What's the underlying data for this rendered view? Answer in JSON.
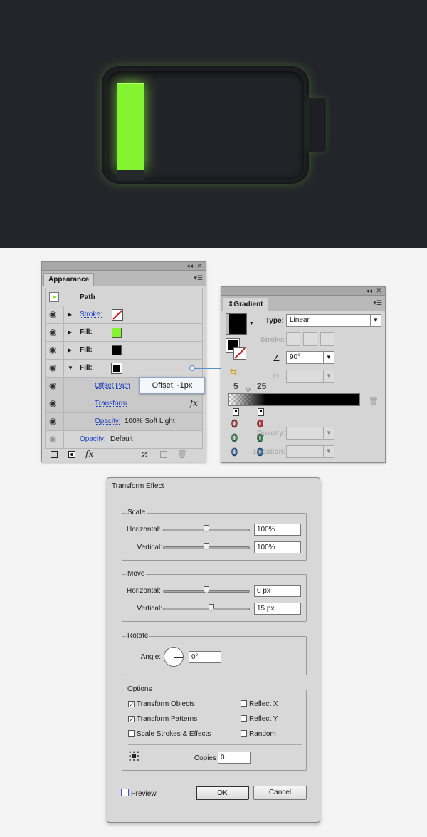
{
  "appearance": {
    "tab_title": "Appearance",
    "header_label": "Path",
    "rows": [
      {
        "label": "Stroke:",
        "is_link": true,
        "expanded": false
      },
      {
        "label": "Fill:",
        "is_link": false,
        "expanded": false,
        "swatch_color": "#85f430"
      },
      {
        "label": "Fill:",
        "is_link": false,
        "expanded": false,
        "swatch_color": "#000000"
      },
      {
        "label": "Fill:",
        "is_link": false,
        "expanded": true,
        "swatch_color": "#000000"
      }
    ],
    "subrows": [
      {
        "label": "Offset Path"
      },
      {
        "label": "Transform"
      },
      {
        "label": "Opacity:",
        "value": "100% Soft Light"
      }
    ],
    "opacity_row": {
      "label": "Opacity:",
      "value": "Default"
    },
    "tooltip": "Offset: -1px",
    "fx_label": "fx"
  },
  "gradient": {
    "tab_title": "Gradient",
    "type_label": "Type:",
    "type_value": "Linear",
    "stroke_label": "Stroke:",
    "angle_value": "90°",
    "stop_numbers": [
      "5",
      "25"
    ],
    "stop_values": [
      "0",
      "0",
      "0",
      "0",
      "0",
      "0"
    ],
    "opacity_label": "Opacity:",
    "location_label": "Location:"
  },
  "transform": {
    "title": "Transform Effect",
    "scale": {
      "title": "Scale",
      "horizontal_label": "Horizontal:",
      "horizontal_value": "100%",
      "vertical_label": "Vertical:",
      "vertical_value": "100%"
    },
    "move": {
      "title": "Move",
      "horizontal_label": "Horizontal:",
      "horizontal_value": "0 px",
      "vertical_label": "Vertical:",
      "vertical_value": "15 px"
    },
    "rotate": {
      "title": "Rotate",
      "angle_label": "Angle:",
      "angle_value": "0°"
    },
    "options": {
      "title": "Options",
      "transform_objects": "Transform Objects",
      "transform_patterns": "Transform Patterns",
      "scale_strokes": "Scale Strokes & Effects",
      "reflect_x": "Reflect X",
      "reflect_y": "Reflect Y",
      "random": "Random",
      "copies_label": "Copies",
      "copies_value": "0"
    },
    "preview_label": "Preview",
    "ok_label": "OK",
    "cancel_label": "Cancel"
  },
  "colors": {
    "accent_green": "#85f430",
    "canvas_bg": "#24252b",
    "link_blue": "#1c3fc1"
  }
}
